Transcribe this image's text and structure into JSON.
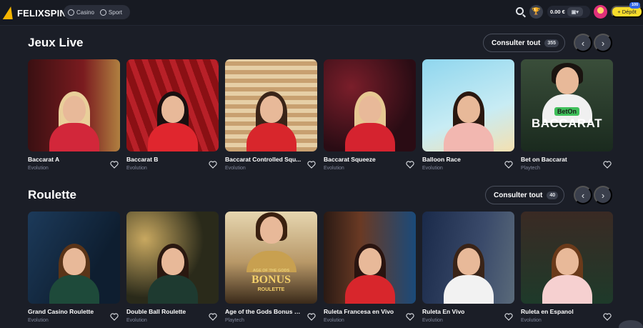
{
  "header": {
    "logo": "FELIXSPIN",
    "nav": [
      {
        "label": "Casino"
      },
      {
        "label": "Sport"
      }
    ],
    "balance": "0.00 €",
    "deposit_label": "Dépôt",
    "deposit_badge": "100"
  },
  "sections": [
    {
      "title": "Jeux Live",
      "see_all_label": "Consulter tout",
      "count": "355",
      "cards": [
        {
          "title": "Baccarat A",
          "provider": "Evolution"
        },
        {
          "title": "Baccarat B",
          "provider": "Evolution"
        },
        {
          "title": "Baccarat Controlled Squ...",
          "provider": "Evolution"
        },
        {
          "title": "Baccarat Squeeze",
          "provider": "Evolution"
        },
        {
          "title": "Balloon Race",
          "provider": "Evolution"
        },
        {
          "title": "Bet on Baccarat",
          "provider": "Playtech",
          "overlay_top": "BetOn",
          "overlay_main": "BACCARAT"
        }
      ]
    },
    {
      "title": "Roulette",
      "see_all_label": "Consulter tout",
      "count": "40",
      "cards": [
        {
          "title": "Grand Casino Roulette",
          "provider": "Evolution"
        },
        {
          "title": "Double Ball Roulette",
          "provider": "Evolution"
        },
        {
          "title": "Age of the Gods Bonus R...",
          "provider": "Playtech",
          "overlay_top": "AGE OF THE GODS",
          "overlay_main": "BONUS",
          "overlay_sub": "ROULETTE"
        },
        {
          "title": "Ruleta Francesa en Vivo",
          "provider": "Evolution"
        },
        {
          "title": "Ruleta En Vivo",
          "provider": "Evolution"
        },
        {
          "title": "Ruleta en Espanol",
          "provider": "Evolution"
        }
      ]
    }
  ],
  "colors": {
    "background": "#1b1e27",
    "accent_yellow": "#f7dc2b",
    "badge_blue": "#3267e6"
  }
}
